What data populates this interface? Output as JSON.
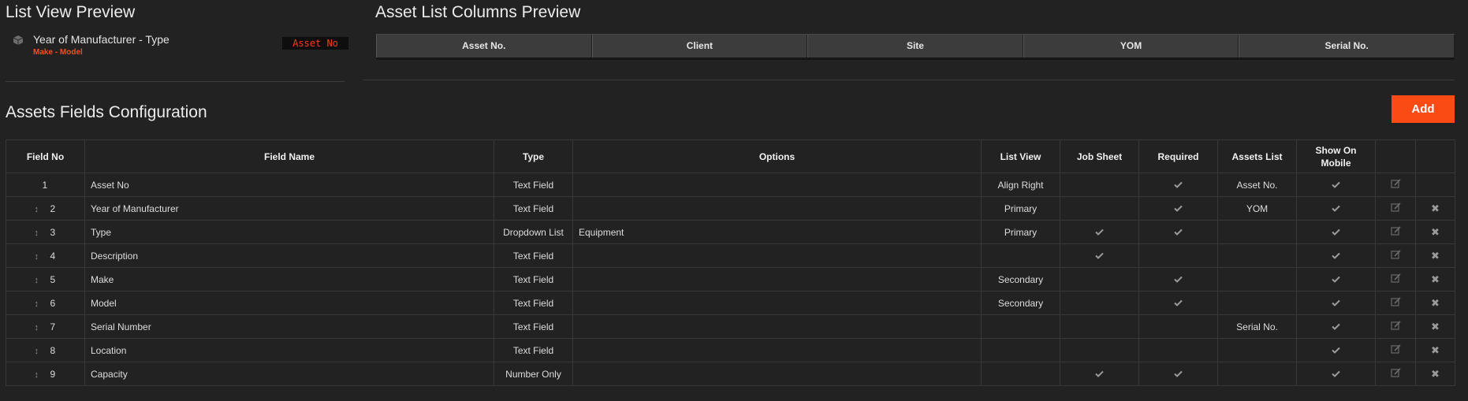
{
  "list_view_preview": {
    "title": "List View Preview",
    "item": {
      "main": "Year of Manufacturer - Type",
      "sub": "Make - Model",
      "badge": "Asset No"
    }
  },
  "asset_list_preview": {
    "title": "Asset List Columns Preview",
    "columns": [
      "Asset No.",
      "Client",
      "Site",
      "YOM",
      "Serial No."
    ]
  },
  "config": {
    "title": "Assets Fields Configuration",
    "add_label": "Add",
    "headers": {
      "field_no": "Field No",
      "field_name": "Field Name",
      "type": "Type",
      "options": "Options",
      "list_view": "List View",
      "job_sheet": "Job Sheet",
      "required": "Required",
      "assets_list": "Assets List",
      "show_mobile": "Show On Mobile"
    },
    "rows": [
      {
        "no": "1",
        "name": "Asset No",
        "type": "Text Field",
        "options": "",
        "list_view": "Align Right",
        "job_sheet": false,
        "required": true,
        "assets_list": "Asset No.",
        "mobile": true,
        "draggable": false,
        "deletable": false
      },
      {
        "no": "2",
        "name": "Year of Manufacturer",
        "type": "Text Field",
        "options": "",
        "list_view": "Primary",
        "job_sheet": false,
        "required": true,
        "assets_list": "YOM",
        "mobile": true,
        "draggable": true,
        "deletable": true
      },
      {
        "no": "3",
        "name": "Type",
        "type": "Dropdown List",
        "options": "Equipment",
        "list_view": "Primary",
        "job_sheet": true,
        "required": true,
        "assets_list": "",
        "mobile": true,
        "draggable": true,
        "deletable": true
      },
      {
        "no": "4",
        "name": "Description",
        "type": "Text Field",
        "options": "",
        "list_view": "",
        "job_sheet": true,
        "required": false,
        "assets_list": "",
        "mobile": true,
        "draggable": true,
        "deletable": true
      },
      {
        "no": "5",
        "name": "Make",
        "type": "Text Field",
        "options": "",
        "list_view": "Secondary",
        "job_sheet": false,
        "required": true,
        "assets_list": "",
        "mobile": true,
        "draggable": true,
        "deletable": true
      },
      {
        "no": "6",
        "name": "Model",
        "type": "Text Field",
        "options": "",
        "list_view": "Secondary",
        "job_sheet": false,
        "required": true,
        "assets_list": "",
        "mobile": true,
        "draggable": true,
        "deletable": true
      },
      {
        "no": "7",
        "name": "Serial Number",
        "type": "Text Field",
        "options": "",
        "list_view": "",
        "job_sheet": false,
        "required": false,
        "assets_list": "Serial No.",
        "mobile": true,
        "draggable": true,
        "deletable": true
      },
      {
        "no": "8",
        "name": "Location",
        "type": "Text Field",
        "options": "",
        "list_view": "",
        "job_sheet": false,
        "required": false,
        "assets_list": "",
        "mobile": true,
        "draggable": true,
        "deletable": true
      },
      {
        "no": "9",
        "name": "Capacity",
        "type": "Number Only",
        "options": "",
        "list_view": "",
        "job_sheet": true,
        "required": true,
        "assets_list": "",
        "mobile": true,
        "draggable": true,
        "deletable": true
      }
    ]
  },
  "icons": {
    "list_item": "cube-icon",
    "check": "check-icon",
    "edit": "edit-icon",
    "delete": "close-icon",
    "drag": "drag-handle-icon"
  },
  "colors": {
    "background": "#222222",
    "accent": "#fb4b15",
    "badge_text": "#ff3a1a",
    "header_cell": "#3c3c3c"
  }
}
